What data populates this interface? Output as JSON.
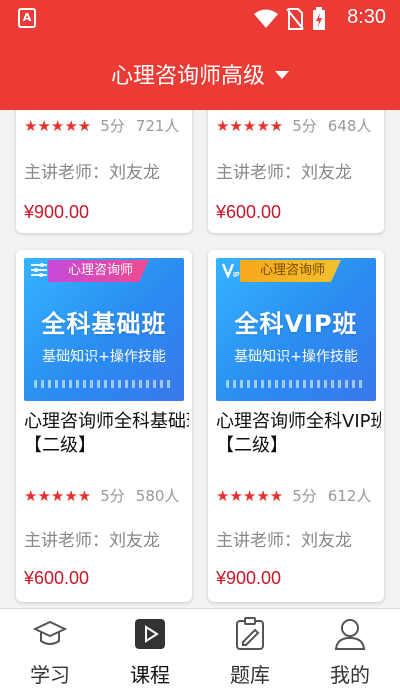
{
  "status_bar": {
    "app_badge": "A",
    "time": "8:30"
  },
  "header": {
    "title": "心理咨询师高级"
  },
  "cards": [
    {
      "rating": "5分",
      "learners": "721人",
      "teacher": "主讲老师：刘友龙",
      "price": "¥900.00"
    },
    {
      "rating": "5分",
      "learners": "648人",
      "teacher": "主讲老师：刘友龙",
      "price": "¥600.00"
    },
    {
      "badge": "心理咨询师",
      "thumb_title": "全科基础班",
      "thumb_sub": "基础知识+操作技能",
      "title_line1": "心理咨询师全科基础班",
      "title_line2": "【二级】",
      "rating": "5分",
      "learners": "580人",
      "teacher": "主讲老师：刘友龙",
      "price": "¥600.00"
    },
    {
      "badge": "心理咨询师",
      "thumb_title": "全科VIP班",
      "thumb_sub": "基础知识+操作技能",
      "title_line1": "心理咨询师全科VIP班",
      "title_line2": "【二级】",
      "rating": "5分",
      "learners": "612人",
      "teacher": "主讲老师：刘友龙",
      "price": "¥900.00"
    }
  ],
  "stars_text": "★★★★★",
  "tabs": [
    {
      "label": "学习",
      "icon": "graduation-cap-icon"
    },
    {
      "label": "课程",
      "icon": "play-icon"
    },
    {
      "label": "题库",
      "icon": "clipboard-edit-icon"
    },
    {
      "label": "我的",
      "icon": "user-icon"
    }
  ],
  "colors": {
    "primary": "#ec3a35",
    "price": "#c8162a",
    "star": "#e8302c"
  }
}
